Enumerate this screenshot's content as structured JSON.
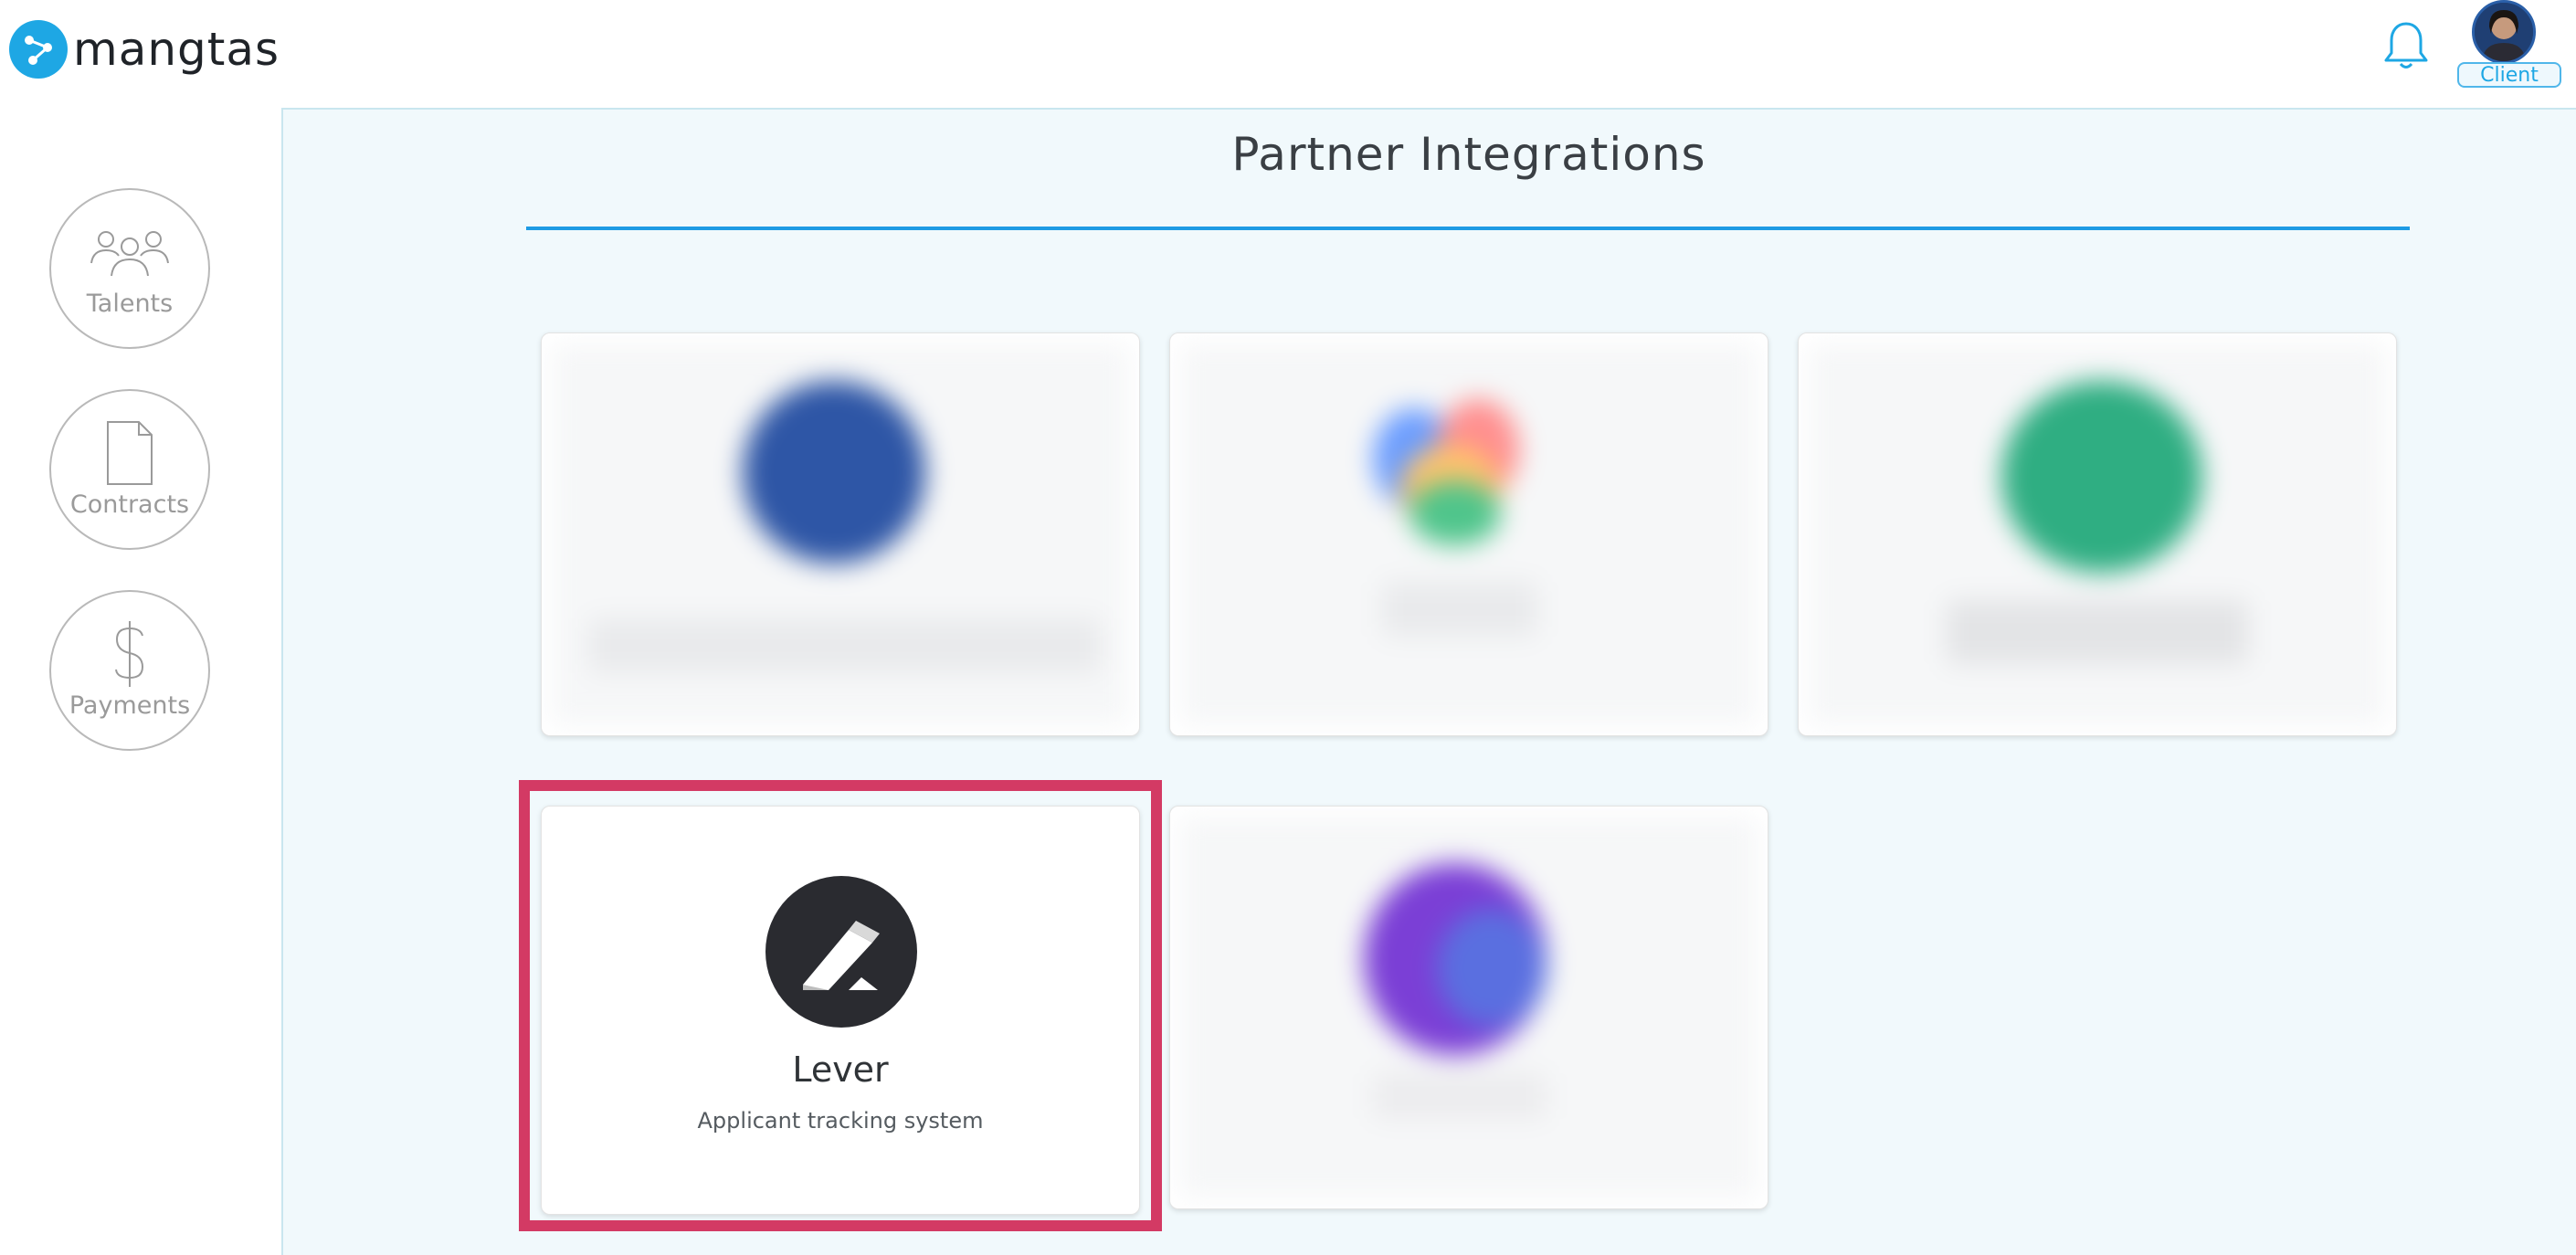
{
  "header": {
    "brand": "mangtas",
    "role_badge": "Client",
    "accent_color": "#1ea7e4"
  },
  "sidebar": {
    "items": [
      {
        "label": "Talents",
        "icon": "people-icon"
      },
      {
        "label": "Contracts",
        "icon": "document-icon"
      },
      {
        "label": "Payments",
        "icon": "dollar-icon"
      }
    ]
  },
  "main": {
    "title": "Partner Integrations",
    "highlight_color": "#d33a64",
    "featured_card": {
      "name": "Lever",
      "description": "Applicant tracking system",
      "icon": "lever-logo-icon"
    }
  }
}
